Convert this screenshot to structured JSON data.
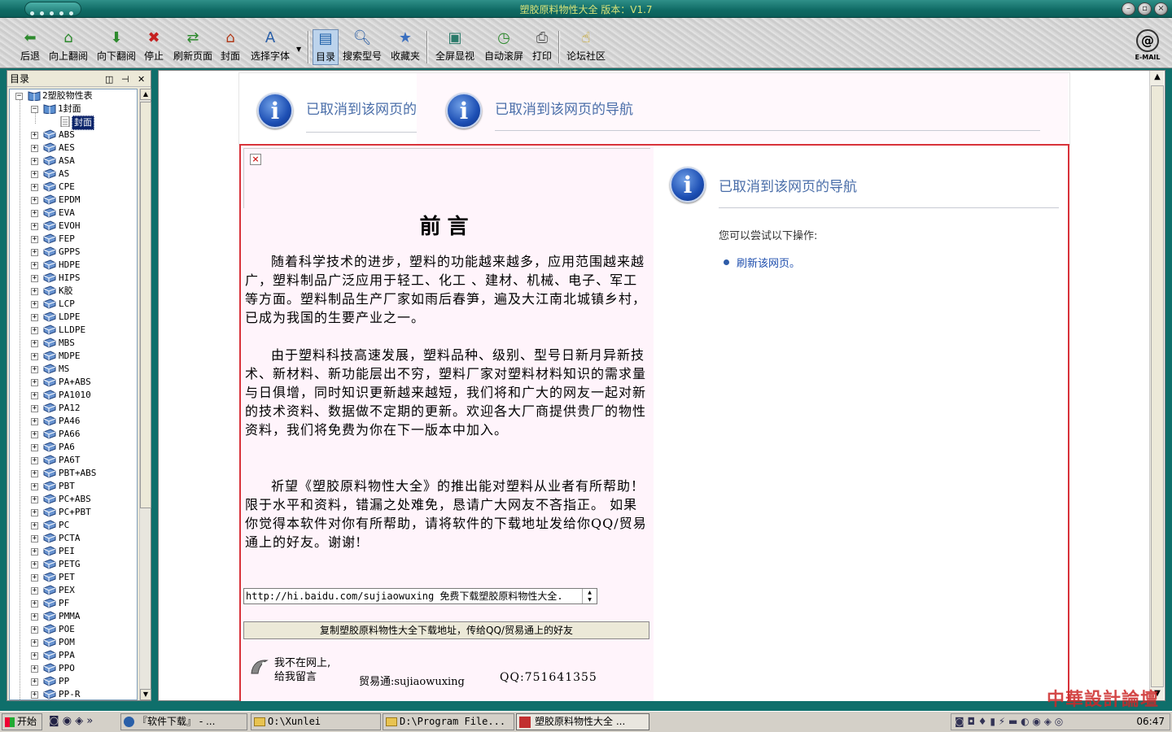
{
  "window": {
    "title": "塑胶原料物性大全 版本：V1.7",
    "controls": [
      "minimize",
      "restore",
      "close"
    ]
  },
  "toolbar": {
    "buttons": [
      {
        "label": "后退",
        "icon": "back-arrow-icon"
      },
      {
        "label": "向上翻阅",
        "icon": "home-up-icon"
      },
      {
        "label": "向下翻阅",
        "icon": "down-arrow-icon"
      },
      {
        "label": "停止",
        "icon": "stop-icon"
      },
      {
        "label": "刷新页面",
        "icon": "refresh-icon"
      },
      {
        "label": "封面",
        "icon": "house-icon"
      },
      {
        "label": "选择字体",
        "icon": "font-icon"
      },
      {
        "label": "目录",
        "icon": "toc-icon"
      },
      {
        "label": "搜索型号",
        "icon": "search-icon"
      },
      {
        "label": "收藏夹",
        "icon": "star-icon"
      },
      {
        "label": "全屏显视",
        "icon": "fullscreen-icon"
      },
      {
        "label": "自动滚屏",
        "icon": "autoscroll-icon"
      },
      {
        "label": "打印",
        "icon": "printer-icon"
      },
      {
        "label": "论坛社区",
        "icon": "pointer-icon"
      }
    ],
    "email_label": "E-MAIL"
  },
  "toc": {
    "header": "目录",
    "root": "2塑胶物性表",
    "cover_folder": "1封面",
    "cover_page": "封面",
    "items": [
      "ABS",
      "AES",
      "ASA",
      "AS",
      "CPE",
      "EPDM",
      "EVA",
      "EVOH",
      "FEP",
      "GPPS",
      "HDPE",
      "HIPS",
      "K胶",
      "LCP",
      "LDPE",
      "LLDPE",
      "MBS",
      "MDPE",
      "MS",
      "PA+ABS",
      "PA1010",
      "PA12",
      "PA46",
      "PA66",
      "PA6",
      "PA6T",
      "PBT+ABS",
      "PBT",
      "PC+ABS",
      "PC+PBT",
      "PC",
      "PCTA",
      "PEI",
      "PETG",
      "PET",
      "PEX",
      "PF",
      "PMMA",
      "POE",
      "POM",
      "PPA",
      "PPO",
      "PP",
      "PP-R"
    ]
  },
  "content": {
    "nav_error_title": "已取消到该网页的导航",
    "nav_error_title_truncated": "已取消到该网页的",
    "try_text": "您可以尝试以下操作:",
    "refresh_link": "刷新该网页。",
    "preface": {
      "title": "前言",
      "para1": "随着科学技术的进步，塑料的功能越来越多，应用范围越来越广，塑料制品广泛应用于轻工、化工 、建材、机械、电子、军工等方面。塑料制品生产厂家如雨后春笋，遍及大江南北城镇乡村，已成为我国的生要产业之一。",
      "para2": "由于塑料科技高速发展，塑料品种、级别、型号日新月异新技术、新材料、新功能层出不穷，塑料厂家对塑料材料知识的需求量与日俱增，同时知识更新越来越短，我们将和广大的网友一起对新的技术资料、数据做不定期的更新。欢迎各大厂商提供贵厂的物性资料，我们将免费为你在下一版本中加入。",
      "para3": "祈望《塑胶原料物性大全》的推出能对塑料从业者有所帮助！限于水平和资料，错漏之处难免，恳请广大网友不吝指正。 如果你觉得本软件对你有所帮助，请将软件的下载地址发给你QQ/贸易通上的好友。谢谢!",
      "url_value": "http://hi.baidu.com/sujiaowuxing 免费下载塑胶原料物性大全.",
      "copy_button": "复制塑胶原料物性大全下载地址，传给QQ/贸易通上的好友",
      "offline_line1": "我不在网上,",
      "offline_line2": "给我留言",
      "trade_contact": "贸易通:sujiaowuxing",
      "qq_contact": "QQ:751641355"
    }
  },
  "taskbar": {
    "start": "开始",
    "tasks": [
      "『软件下载』 - ...",
      "O:\\Xunlei",
      "D:\\Program File...",
      "塑胶原料物性大全 ..."
    ],
    "clock": "06:47"
  },
  "watermark": "中華設計論壇"
}
